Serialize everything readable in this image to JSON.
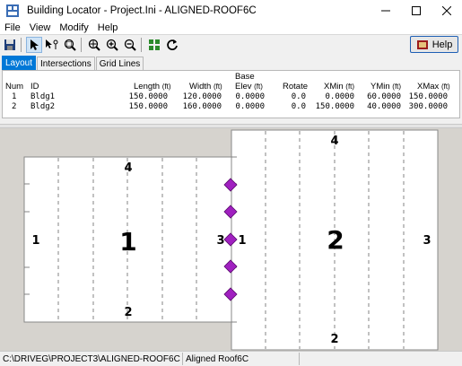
{
  "window": {
    "title": "Building Locator - Project.Ini - ALIGNED-ROOF6C"
  },
  "menu": [
    "File",
    "View",
    "Modify",
    "Help"
  ],
  "toolbar": {
    "help_label": "Help"
  },
  "tabs": [
    "Layout",
    "Intersections",
    "Grid Lines"
  ],
  "table": {
    "headers": {
      "num": "Num",
      "id": "ID",
      "length": "Length",
      "width": "Width",
      "base_top": "Base",
      "elev": "Elev",
      "rotate": "Rotate",
      "xmin": "XMin",
      "ymin": "YMin",
      "xmax": "XMax",
      "unit": "(ft)"
    },
    "rows": [
      {
        "num": "1",
        "id": "Bldg1",
        "length": "150.0000",
        "width": "120.0000",
        "elev": "0.0000",
        "rotate": "0.0",
        "xmin": "0.0000",
        "ymin": "60.0000",
        "xmax": "150.0000"
      },
      {
        "num": "2",
        "id": "Bldg2",
        "length": "150.0000",
        "width": "160.0000",
        "elev": "0.0000",
        "rotate": "0.0",
        "xmin": "150.0000",
        "ymin": "40.0000",
        "xmax": "300.0000"
      }
    ]
  },
  "drawing": {
    "building1": {
      "label": "1",
      "top": "4",
      "bottom": "2",
      "left": "1",
      "right": "3"
    },
    "building2": {
      "label": "2",
      "top": "4",
      "bottom": "2",
      "left": "1",
      "right": "3"
    },
    "marker_color": "#a020c0"
  },
  "status": {
    "path": "C:\\DRIVEG\\PROJECT3\\ALIGNED-ROOF6C",
    "view": "Aligned Roof6C"
  }
}
